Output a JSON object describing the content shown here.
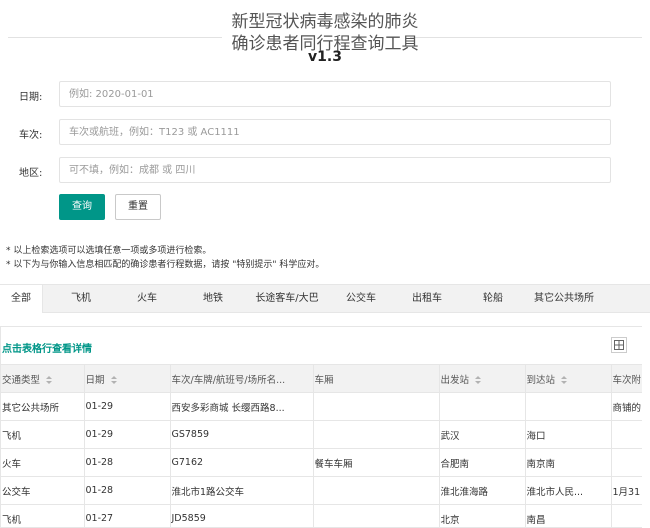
{
  "header": {
    "title_line1": "新型冠状病毒感染的肺炎",
    "title_line2": "确诊患者同行程查询工具",
    "version": "v1.3"
  },
  "form": {
    "date": {
      "label": "日期:",
      "placeholder": "例如: 2020-01-01"
    },
    "train": {
      "label": "车次:",
      "placeholder": "车次或航班，例如：T123 或 AC1111"
    },
    "region": {
      "label": "地区:",
      "placeholder": "可不填，例如：成都 或 四川"
    },
    "search_label": "查询",
    "reset_label": "重置"
  },
  "notes": [
    "* 以上检索选项可以选填任意一项或多项进行检索。",
    "* 以下为与你输入信息相匹配的确诊患者行程数据，请按 \"特别提示\" 科学应对。"
  ],
  "tabs": [
    "全部",
    "飞机",
    "火车",
    "地铁",
    "长途客车/大巴",
    "公交车",
    "出租车",
    "轮船",
    "其它公共场所"
  ],
  "active_tab": 0,
  "table": {
    "hint": "点击表格行查看详情",
    "columns": [
      "交通类型",
      "日期",
      "车次/车牌/航班号/场所名...",
      "车厢",
      "出发站",
      "到达站",
      "车次附"
    ],
    "rows": [
      [
        "其它公共场所",
        "01-29",
        "西安多彩商城 长缨西路8...",
        "",
        "",
        "",
        "商铺的"
      ],
      [
        "飞机",
        "01-29",
        "GS7859",
        "",
        "武汉",
        "海口",
        ""
      ],
      [
        "火车",
        "01-28",
        "G7162",
        "餐车车厢",
        "合肥南",
        "南京南",
        ""
      ],
      [
        "公交车",
        "01-28",
        "淮北市1路公交车",
        "",
        "淮北淮海路",
        "淮北市人民...",
        "1月31"
      ],
      [
        "飞机",
        "01-27",
        "JD5859",
        "",
        "北京",
        "南昌",
        ""
      ]
    ]
  },
  "colors": {
    "primary": "#009688",
    "tab_bg": "#f2f2f2",
    "border": "#e6e6e6"
  },
  "icons": {
    "grid": "grid-icon",
    "sort": "sort-icon"
  }
}
